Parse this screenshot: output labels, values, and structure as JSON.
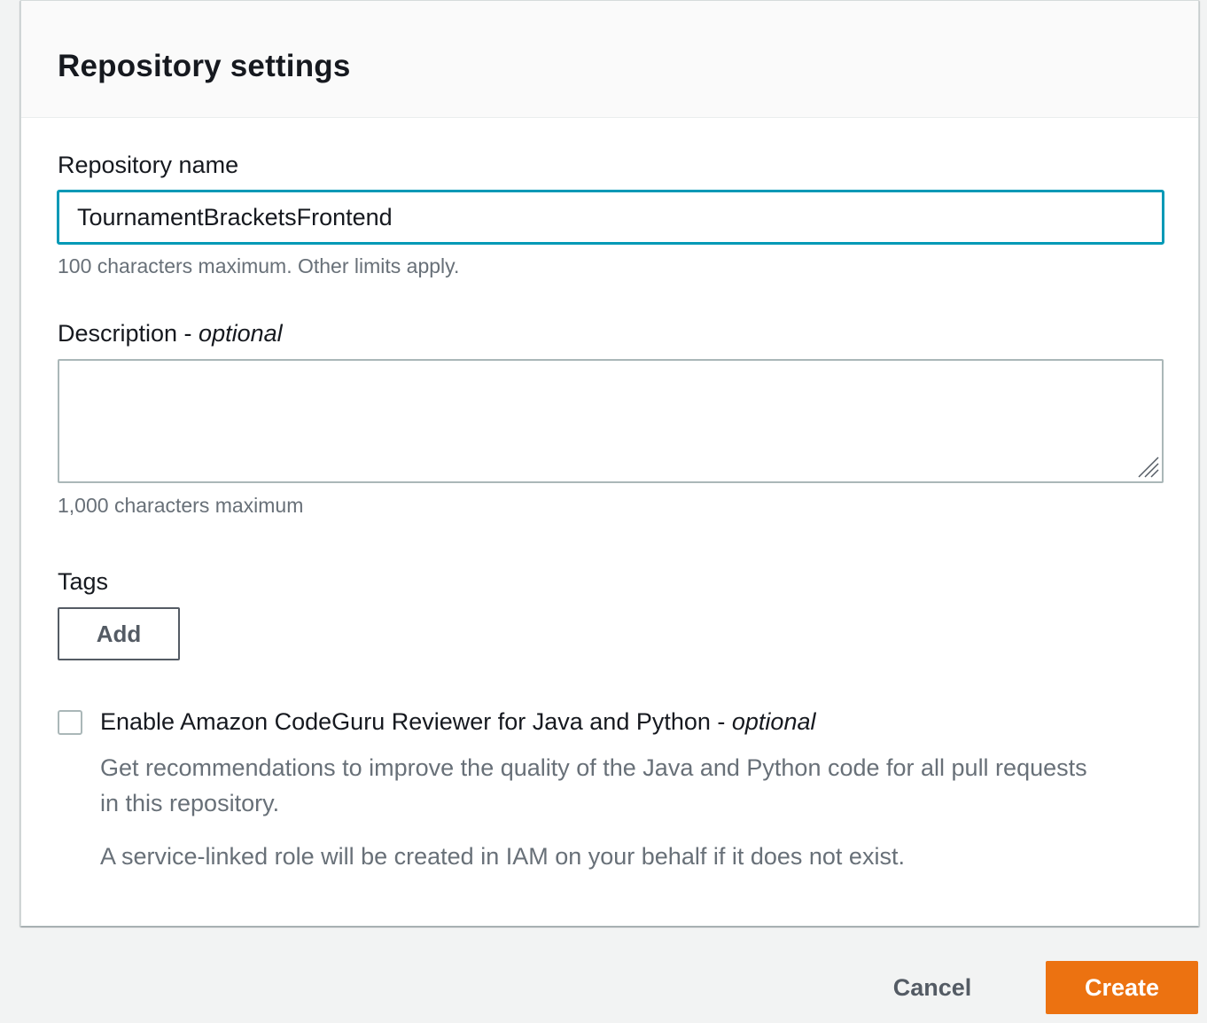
{
  "panel": {
    "title": "Repository settings"
  },
  "repo_name": {
    "label": "Repository name",
    "value": "TournamentBracketsFrontend",
    "hint": "100 characters maximum. Other limits apply."
  },
  "description": {
    "label": "Description - ",
    "optional": "optional",
    "value": "",
    "hint": "1,000 characters maximum"
  },
  "tags": {
    "label": "Tags",
    "add_label": "Add"
  },
  "codeguru": {
    "checked": false,
    "label": "Enable Amazon CodeGuru Reviewer for Java and Python - ",
    "optional": "optional",
    "desc_line1": "Get recommendations to improve the quality of the Java and Python code for all pull requests",
    "desc_line2": "in this repository.",
    "desc_note": "A service-linked role will be created in IAM on your behalf if it does not exist."
  },
  "footer": {
    "cancel_label": "Cancel",
    "create_label": "Create"
  },
  "colors": {
    "accent": "#ec7211",
    "focus": "#0099b6",
    "hint_text": "#687078"
  }
}
